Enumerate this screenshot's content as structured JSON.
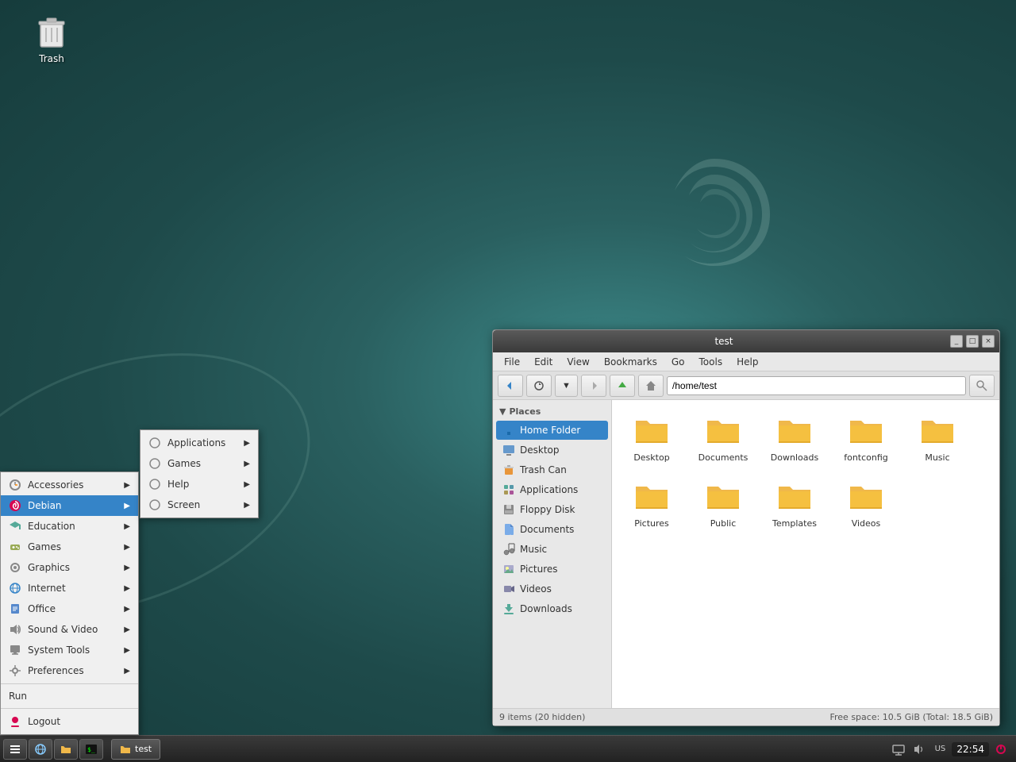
{
  "desktop": {
    "trash_label": "Trash",
    "debian_swirl_alt": "Debian Swirl"
  },
  "taskbar": {
    "time": "22:54",
    "app_menu_label": "▣",
    "active_window": "test"
  },
  "app_menu": {
    "items": [
      {
        "id": "accessories",
        "label": "Accessories",
        "has_arrow": true
      },
      {
        "id": "debian",
        "label": "Debian",
        "has_arrow": true,
        "active": true
      },
      {
        "id": "education",
        "label": "Education",
        "has_arrow": true
      },
      {
        "id": "games",
        "label": "Games",
        "has_arrow": true
      },
      {
        "id": "graphics",
        "label": "Graphics",
        "has_arrow": true
      },
      {
        "id": "internet",
        "label": "Internet",
        "has_arrow": true
      },
      {
        "id": "office",
        "label": "Office",
        "has_arrow": true
      },
      {
        "id": "sound-video",
        "label": "Sound & Video",
        "has_arrow": true
      },
      {
        "id": "system-tools",
        "label": "System Tools",
        "has_arrow": true
      },
      {
        "id": "preferences",
        "label": "Preferences",
        "has_arrow": true
      }
    ],
    "run_label": "Run",
    "logout_label": "Logout"
  },
  "debian_submenu": {
    "items": [
      {
        "id": "applications",
        "label": "Applications",
        "has_arrow": true
      },
      {
        "id": "games",
        "label": "Games",
        "has_arrow": true
      },
      {
        "id": "help",
        "label": "Help",
        "has_arrow": true
      },
      {
        "id": "screen",
        "label": "Screen",
        "has_arrow": true
      }
    ]
  },
  "file_manager": {
    "title": "test",
    "menubar": [
      "File",
      "Edit",
      "View",
      "Bookmarks",
      "Go",
      "Tools",
      "Help"
    ],
    "address": "/home/test",
    "places_label": "Places",
    "sidebar_items": [
      {
        "id": "home",
        "label": "Home Folder",
        "active": true
      },
      {
        "id": "desktop",
        "label": "Desktop"
      },
      {
        "id": "trash",
        "label": "Trash Can"
      },
      {
        "id": "applications",
        "label": "Applications"
      },
      {
        "id": "floppy",
        "label": "Floppy Disk"
      },
      {
        "id": "documents",
        "label": "Documents"
      },
      {
        "id": "music",
        "label": "Music"
      },
      {
        "id": "pictures",
        "label": "Pictures"
      },
      {
        "id": "videos",
        "label": "Videos"
      },
      {
        "id": "downloads",
        "label": "Downloads"
      }
    ],
    "files": [
      {
        "name": "Desktop",
        "type": "folder"
      },
      {
        "name": "Documents",
        "type": "folder"
      },
      {
        "name": "Downloads",
        "type": "folder"
      },
      {
        "name": "fontconfig",
        "type": "folder"
      },
      {
        "name": "Music",
        "type": "folder"
      },
      {
        "name": "Pictures",
        "type": "folder"
      },
      {
        "name": "Public",
        "type": "folder"
      },
      {
        "name": "Templates",
        "type": "folder"
      },
      {
        "name": "Videos",
        "type": "folder"
      }
    ],
    "statusbar_left": "9 items (20 hidden)",
    "statusbar_right": "Free space: 10.5 GiB (Total: 18.5 GiB)"
  }
}
